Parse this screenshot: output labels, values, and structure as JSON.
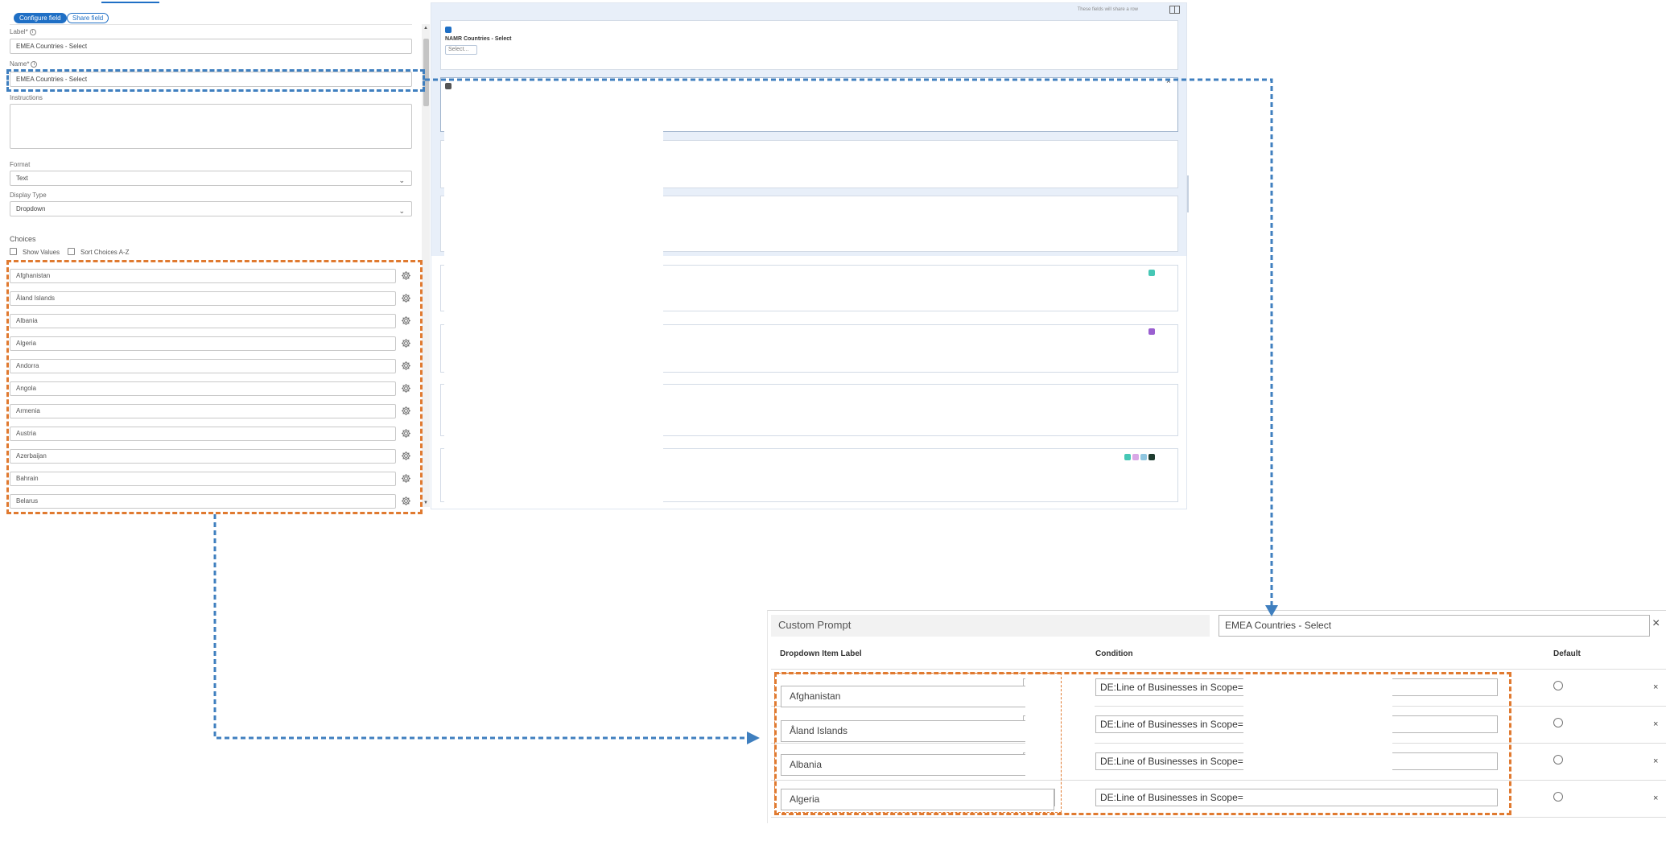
{
  "config": {
    "configure_btn": "Configure field",
    "share_btn": "Share field",
    "label_label": "Label*",
    "label_value": "EMEA Countries - Select",
    "name_label": "Name*",
    "name_value": "EMEA Countries - Select",
    "instructions_label": "Instructions",
    "format_label": "Format",
    "format_value": "Text",
    "display_type_label": "Display Type",
    "display_type_value": "Dropdown",
    "choices_label": "Choices",
    "show_values_label": "Show Values",
    "sort_label": "Sort Choices A-Z",
    "choices": [
      "Afghanistan",
      "Åland Islands",
      "Albania",
      "Algeria",
      "Andorra",
      "Angola",
      "Armenia",
      "Austria",
      "Azerbaijan",
      "Bahrain",
      "Belarus"
    ]
  },
  "preview": {
    "row_hint": "These fields will share a row",
    "namr_title": "NAMR Countries - Select",
    "namr_placeholder": "Select...",
    "close_glyph": "×",
    "chip_colors": {
      "blue": "#1f6fc5",
      "dark": "#555555",
      "teal": "#46c7b5",
      "purple": "#9a5fd0",
      "pink": "#d9a8e6",
      "light_blue": "#8fc6e0",
      "dark_green": "#1d3b2f"
    }
  },
  "custom_prompt": {
    "title": "Custom Prompt",
    "field_name": "EMEA Countries - Select",
    "close_glyph": "×",
    "col_label": "Dropdown Item Label",
    "col_condition": "Condition",
    "col_default": "Default",
    "rows": [
      {
        "label": "Afghanistan",
        "condition": "DE:Line of Businesses in Scope="
      },
      {
        "label": "Åland Islands",
        "condition": "DE:Line of Businesses in Scope="
      },
      {
        "label": "Albania",
        "condition": "DE:Line of Businesses in Scope="
      },
      {
        "label": "Algeria",
        "condition": "DE:Line of Businesses in Scope="
      }
    ],
    "row_remove_glyph": "×"
  },
  "annotation_colors": {
    "blue": "#3f7fbf",
    "orange": "#e07a30"
  }
}
